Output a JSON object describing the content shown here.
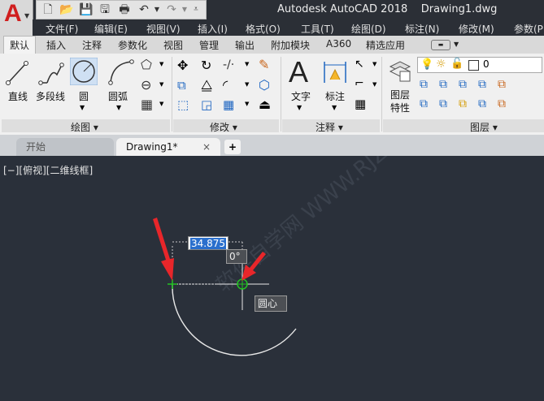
{
  "title": {
    "app_name": "Autodesk AutoCAD 2018",
    "document": "Drawing1.dwg",
    "app_letter": "A"
  },
  "quick_access": [
    "new-file-icon",
    "open-folder-icon",
    "save-icon",
    "save-as-icon",
    "print-icon",
    "undo-icon",
    "redo-icon",
    "customize-icon"
  ],
  "menu": [
    "文件(F)",
    "编辑(E)",
    "视图(V)",
    "插入(I)",
    "格式(O)",
    "工具(T)",
    "绘图(D)",
    "标注(N)",
    "修改(M)",
    "参数(P)"
  ],
  "ribbon_tabs": [
    "默认",
    "插入",
    "注释",
    "参数化",
    "视图",
    "管理",
    "输出",
    "附加模块",
    "A360",
    "精选应用"
  ],
  "ribbon": {
    "draw": {
      "line": "直线",
      "polyline": "多段线",
      "circle": "圆",
      "arc": "圆弧",
      "title": "绘图"
    },
    "modify": {
      "title": "修改"
    },
    "annotation": {
      "text": "文字",
      "dimension": "标注",
      "title": "注释"
    },
    "layers": {
      "properties_line1": "图层",
      "properties_line2": "特性",
      "current_layer": "0",
      "title": "图层"
    }
  },
  "file_tabs": {
    "start": "开始",
    "drawing": "Drawing1*",
    "close": "×",
    "add": "+"
  },
  "viewport": {
    "label": "[−][俯视][二维线框]"
  },
  "dynamic_input": {
    "value": "34.875",
    "angle": "0°",
    "snap": "圆心"
  },
  "watermark": "软件自学网  WWW.RJZXW.COM",
  "colors": {
    "accent": "#d01e1e",
    "canvas": "#2a303a",
    "arc": "#e8e8e8",
    "snap_marker": "#22c322",
    "arrow": "#e8262a",
    "selection": "#2a6fcd"
  }
}
